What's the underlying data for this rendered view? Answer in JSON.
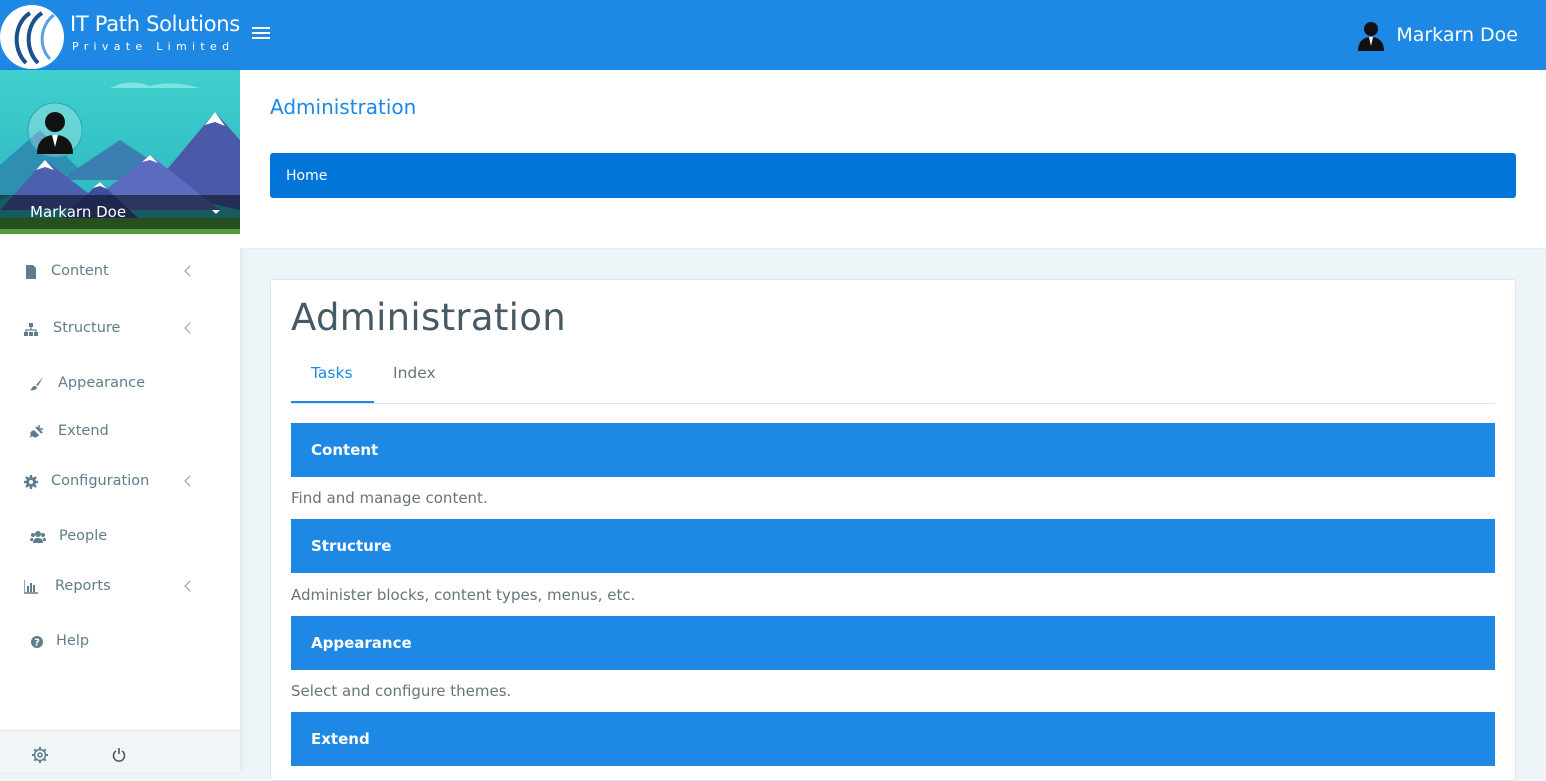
{
  "brand": {
    "title": "IT Path Solutions",
    "subtitle": "Private Limited"
  },
  "header": {
    "user_name": "Markarn Doe",
    "menu_icon": "hamburger-icon"
  },
  "sidebar": {
    "profile_name": "Markarn Doe",
    "items": [
      {
        "label": "Content",
        "icon": "document-icon",
        "has_submenu": true
      },
      {
        "label": "Structure",
        "icon": "sitemap-icon",
        "has_submenu": true
      },
      {
        "label": "Appearance",
        "icon": "paintbrush-icon",
        "has_submenu": false
      },
      {
        "label": "Extend",
        "icon": "plug-icon",
        "has_submenu": false
      },
      {
        "label": "Configuration",
        "icon": "gear-icon",
        "has_submenu": true
      },
      {
        "label": "People",
        "icon": "users-icon",
        "has_submenu": false
      },
      {
        "label": "Reports",
        "icon": "bar-chart-icon",
        "has_submenu": true
      },
      {
        "label": "Help",
        "icon": "question-circle-icon",
        "has_submenu": false
      }
    ],
    "footer_icons": [
      "settings-icon",
      "power-icon"
    ]
  },
  "page": {
    "title": "Administration",
    "breadcrumb": "Home"
  },
  "card": {
    "title": "Administration",
    "tabs": [
      {
        "label": "Tasks",
        "active": true
      },
      {
        "label": "Index",
        "active": false
      }
    ],
    "sections": [
      {
        "title": "Content",
        "description": "Find and manage content."
      },
      {
        "title": "Structure",
        "description": "Administer blocks, content types, menus, etc."
      },
      {
        "title": "Appearance",
        "description": "Select and configure themes."
      },
      {
        "title": "Extend",
        "description": ""
      }
    ]
  },
  "colors": {
    "primary": "#1e88e5",
    "breadcrumb": "#0275d8",
    "background": "#eef5f9"
  }
}
